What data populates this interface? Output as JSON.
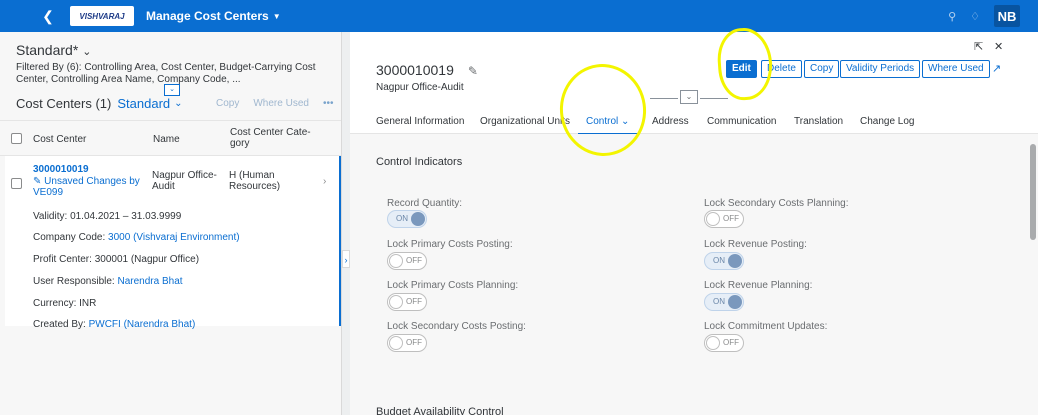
{
  "shell": {
    "logo_text": "VISHVARAJ",
    "app_title": "Manage Cost Centers",
    "user_initials": "NB"
  },
  "list": {
    "variant_name": "Standard*",
    "filtered_by": "Filtered By (6): Controlling Area, Cost Center, Budget-Carrying Cost Center, Controlling Area Name, Company Code, ...",
    "title": "Cost Centers (1)",
    "table_variant": "Standard",
    "copy_label": "Copy",
    "where_used_label": "Where Used",
    "columns": [
      "Cost Center",
      "Name",
      "Cost Center Category"
    ],
    "columns_display": [
      "Cost Center",
      "Name",
      "Cost Center Cate-",
      "gory"
    ],
    "row": {
      "id": "3000010019",
      "status_line1": "Unsaved Changes by",
      "status_line2": "VE099",
      "name_line1": "Nagpur Office-",
      "name_line2": "Audit",
      "category_line1": "H (Human",
      "category_line2": "Resources)",
      "details": [
        {
          "label": "Validity:",
          "value": "01.04.2021 – 31.03.9999",
          "link": false
        },
        {
          "label": "Company Code:",
          "value": "3000 (Vishvaraj Environment)",
          "link": true
        },
        {
          "label": "Profit Center:",
          "value": "300001 (Nagpur Office)",
          "link": false
        },
        {
          "label": "User Responsible:",
          "value": "Narendra Bhat",
          "link": true
        },
        {
          "label": "Currency:",
          "value": "INR",
          "link": false
        },
        {
          "label": "Created By:",
          "value": "PWCFI (Narendra Bhat)",
          "link": true
        }
      ]
    }
  },
  "object": {
    "id": "3000010019",
    "subtitle": "Nagpur Office-Audit",
    "buttons": {
      "edit": "Edit",
      "delete": "Delete",
      "copy": "Copy",
      "validity": "Validity Periods",
      "where_used": "Where Used"
    },
    "tabs": [
      "General Information",
      "Organizational Units",
      "Control",
      "Address",
      "Communication",
      "Translation",
      "Change Log"
    ],
    "active_tab": "Control",
    "section_title": "Control Indicators",
    "indicators": [
      {
        "label": "Record Quantity:",
        "state": "ON"
      },
      {
        "label": "Lock Secondary Costs Planning:",
        "state": "OFF"
      },
      {
        "label": "Lock Primary Costs Posting:",
        "state": "OFF"
      },
      {
        "label": "Lock Revenue Posting:",
        "state": "ON"
      },
      {
        "label": "Lock Primary Costs Planning:",
        "state": "OFF"
      },
      {
        "label": "Lock Revenue Planning:",
        "state": "ON"
      },
      {
        "label": "Lock Secondary Costs Posting:",
        "state": "OFF"
      },
      {
        "label": "Lock Commitment Updates:",
        "state": "OFF"
      }
    ],
    "next_section": "Budget Availability Control"
  },
  "colors": {
    "shell": "#0a6ed1",
    "accent": "#0a6ed1",
    "annotation": "#f3f500"
  }
}
